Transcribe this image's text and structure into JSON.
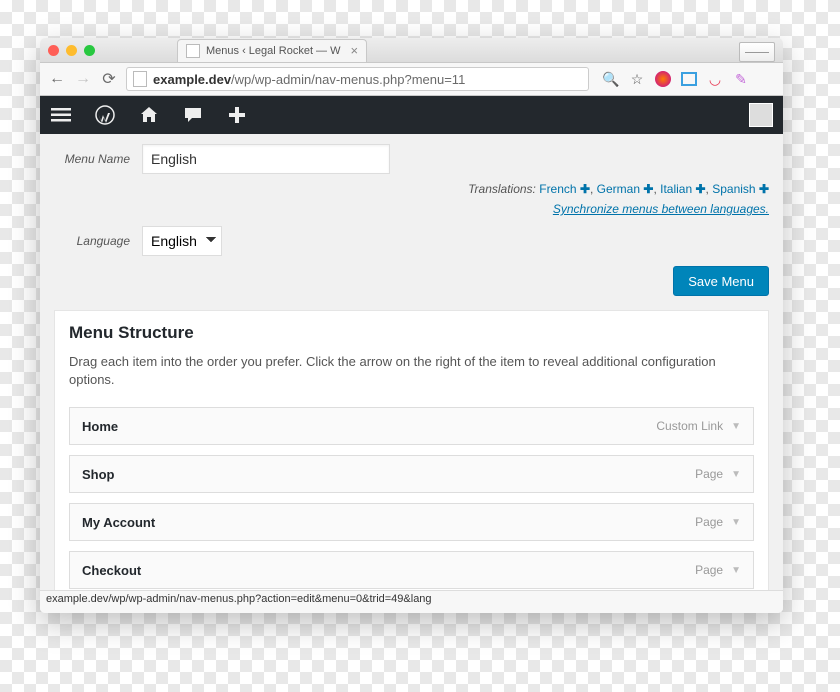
{
  "window": {
    "tab_title": "Menus ‹ Legal Rocket — W"
  },
  "url": {
    "host": "example.dev",
    "path": "/wp/wp-admin/nav-menus.php?menu=11"
  },
  "form": {
    "menu_name_label": "Menu Name",
    "menu_name_value": "English",
    "language_label": "Language",
    "language_value": "English"
  },
  "translations": {
    "prefix": "Translations:",
    "items": [
      "French",
      "German",
      "Italian",
      "Spanish"
    ],
    "sync_text": "Synchronize menus between languages."
  },
  "buttons": {
    "save_menu": "Save Menu"
  },
  "structure": {
    "heading": "Menu Structure",
    "help": "Drag each item into the order you prefer. Click the arrow on the right of the item to reveal additional configuration options.",
    "items": [
      {
        "name": "Home",
        "type": "Custom Link"
      },
      {
        "name": "Shop",
        "type": "Page"
      },
      {
        "name": "My Account",
        "type": "Page"
      },
      {
        "name": "Checkout",
        "type": "Page"
      }
    ]
  },
  "status_bar": "example.dev/wp/wp-admin/nav-menus.php?action=edit&menu=0&trid=49&lang"
}
